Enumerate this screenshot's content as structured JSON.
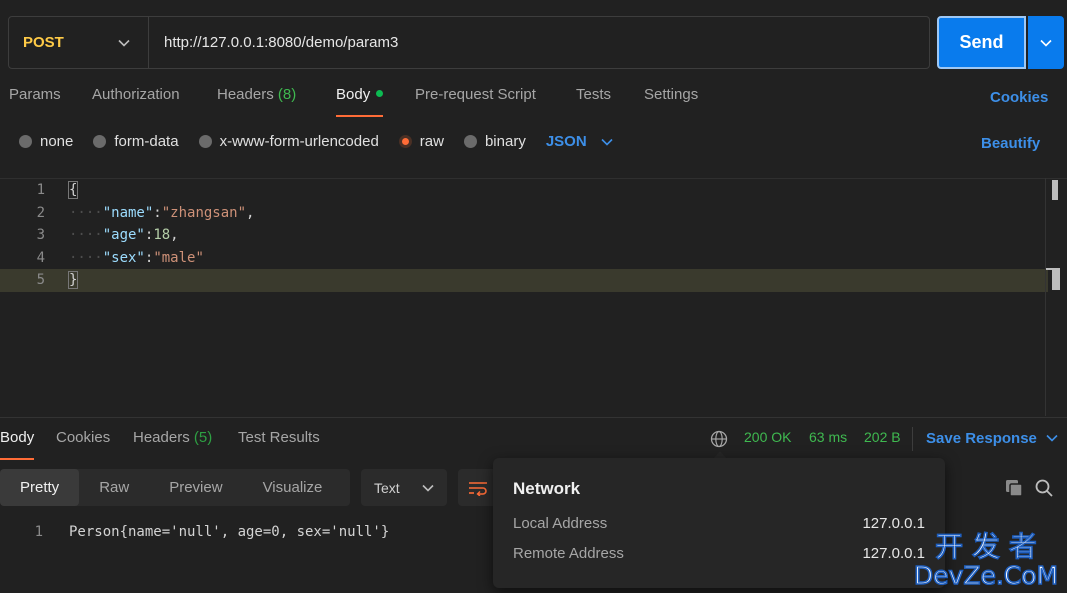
{
  "request": {
    "method": "POST",
    "url": "http://127.0.0.1:8080/demo/param3",
    "send_label": "Send"
  },
  "request_tabs": {
    "params": "Params",
    "authorization": "Authorization",
    "headers": "Headers",
    "headers_count": "(8)",
    "body": "Body",
    "pre_request": "Pre-request Script",
    "tests": "Tests",
    "settings": "Settings",
    "cookies": "Cookies"
  },
  "body_types": {
    "none": "none",
    "form_data": "form-data",
    "urlencoded": "x-www-form-urlencoded",
    "raw": "raw",
    "binary": "binary",
    "format": "JSON",
    "beautify": "Beautify"
  },
  "editor": {
    "line_numbers": [
      "1",
      "2",
      "3",
      "4",
      "5"
    ],
    "open_brace": "{",
    "close_brace": "}",
    "indent": "····",
    "fields": [
      {
        "key": "\"name\"",
        "colon": ":",
        "value": "\"zhangsan\"",
        "comma": ",",
        "type": "string"
      },
      {
        "key": "\"age\"",
        "colon": ":",
        "value": "18",
        "comma": ",",
        "type": "number"
      },
      {
        "key": "\"sex\"",
        "colon": ":",
        "value": "\"male\"",
        "comma": "",
        "type": "string"
      }
    ]
  },
  "response_tabs": {
    "body": "Body",
    "cookies": "Cookies",
    "headers": "Headers",
    "headers_count": "(5)",
    "test_results": "Test Results"
  },
  "status": {
    "code": "200 OK",
    "time": "63 ms",
    "size": "202 B",
    "save": "Save Response"
  },
  "view_modes": {
    "pretty": "Pretty",
    "raw": "Raw",
    "preview": "Preview",
    "visualize": "Visualize",
    "text_format": "Text"
  },
  "response_body": {
    "line_number": "1",
    "text": "Person{name='null', age=0, sex='null'}"
  },
  "network_popover": {
    "title": "Network",
    "local_label": "Local Address",
    "local_value": "127.0.0.1",
    "remote_label": "Remote Address",
    "remote_value": "127.0.0.1"
  },
  "watermark": {
    "top": "开 发 者",
    "bottom": "DevZe.CoM"
  },
  "colors": {
    "accent_orange": "#ff6c37",
    "method_yellow": "#ffcb47",
    "link_blue": "#3d8fe8",
    "send_blue": "#097bed",
    "status_green": "#3fb950"
  }
}
